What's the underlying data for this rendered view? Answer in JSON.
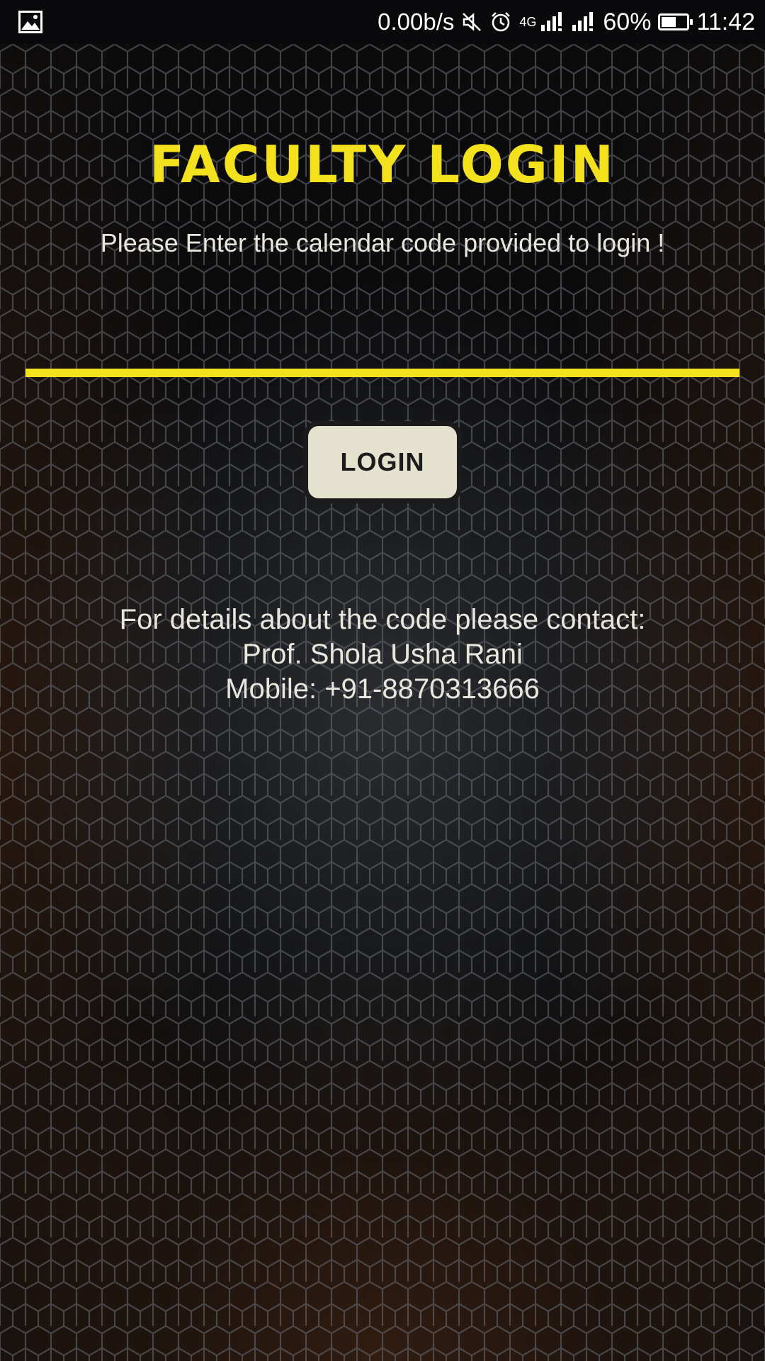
{
  "status_bar": {
    "left_icons": [
      "image-notification-icon"
    ],
    "net_speed": "0.00b/s",
    "network_type": "4G",
    "battery_percent": "60%",
    "battery_level": 0.6,
    "time": "11:42",
    "icons": [
      "mute-icon",
      "alarm-icon",
      "signal-icon",
      "signal-icon"
    ]
  },
  "login": {
    "title": "FACULTY LOGIN",
    "instruction": "Please Enter the calendar code provided to login !",
    "code_value": "",
    "button_label": "LOGIN"
  },
  "contact": {
    "line1": "For details about the code please contact:",
    "line2": "Prof. Shola Usha Rani",
    "line3": "Mobile: +91-8870313666"
  },
  "colors": {
    "accent": "#f2e11c",
    "button_bg": "#e4e2cf",
    "text": "#e9e6de",
    "background": "#0b0b0c"
  }
}
